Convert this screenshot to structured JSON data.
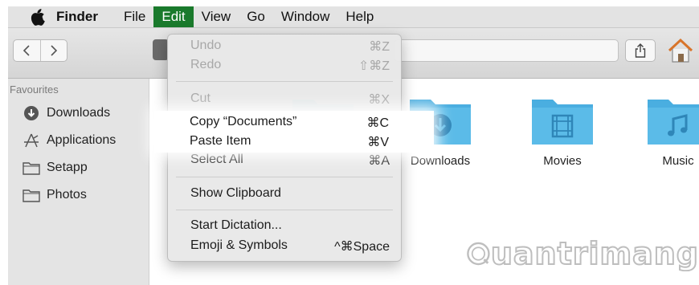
{
  "menubar": {
    "app_name": "Finder",
    "items": [
      "File",
      "Edit",
      "View",
      "Go",
      "Window",
      "Help"
    ],
    "active_item": "Edit",
    "active_color": "#1a7a2c"
  },
  "sidebar": {
    "heading": "Favourites",
    "items": [
      {
        "label": "Downloads",
        "icon": "download-circle-icon"
      },
      {
        "label": "Applications",
        "icon": "applications-icon"
      },
      {
        "label": "Setapp",
        "icon": "folder-icon"
      },
      {
        "label": "Photos",
        "icon": "folder-icon"
      }
    ]
  },
  "folders": [
    {
      "label": "",
      "icon": "folder-icon"
    },
    {
      "label": "Downloads",
      "icon": "download-folder-icon"
    },
    {
      "label": "Movies",
      "icon": "film-folder-icon"
    },
    {
      "label": "Music",
      "icon": "music-folder-icon"
    }
  ],
  "edit_menu": {
    "undo": {
      "label": "Undo",
      "shortcut": "⌘Z"
    },
    "redo": {
      "label": "Redo",
      "shortcut": "⇧⌘Z"
    },
    "cut": {
      "label": "Cut",
      "shortcut": "⌘X"
    },
    "copy": {
      "label": "Copy “Documents”",
      "shortcut": "⌘C"
    },
    "paste": {
      "label": "Paste Item",
      "shortcut": "⌘V"
    },
    "select_all": {
      "label": "Select All",
      "shortcut": "⌘A"
    },
    "show_clipboard": {
      "label": "Show Clipboard"
    },
    "start_dictation": {
      "label": "Start Dictation..."
    },
    "emoji": {
      "label": "Emoji & Symbols",
      "shortcut": "^⌘Space"
    }
  },
  "folder_color": "#4aaee0",
  "watermark": {
    "text": "uantrimang"
  }
}
